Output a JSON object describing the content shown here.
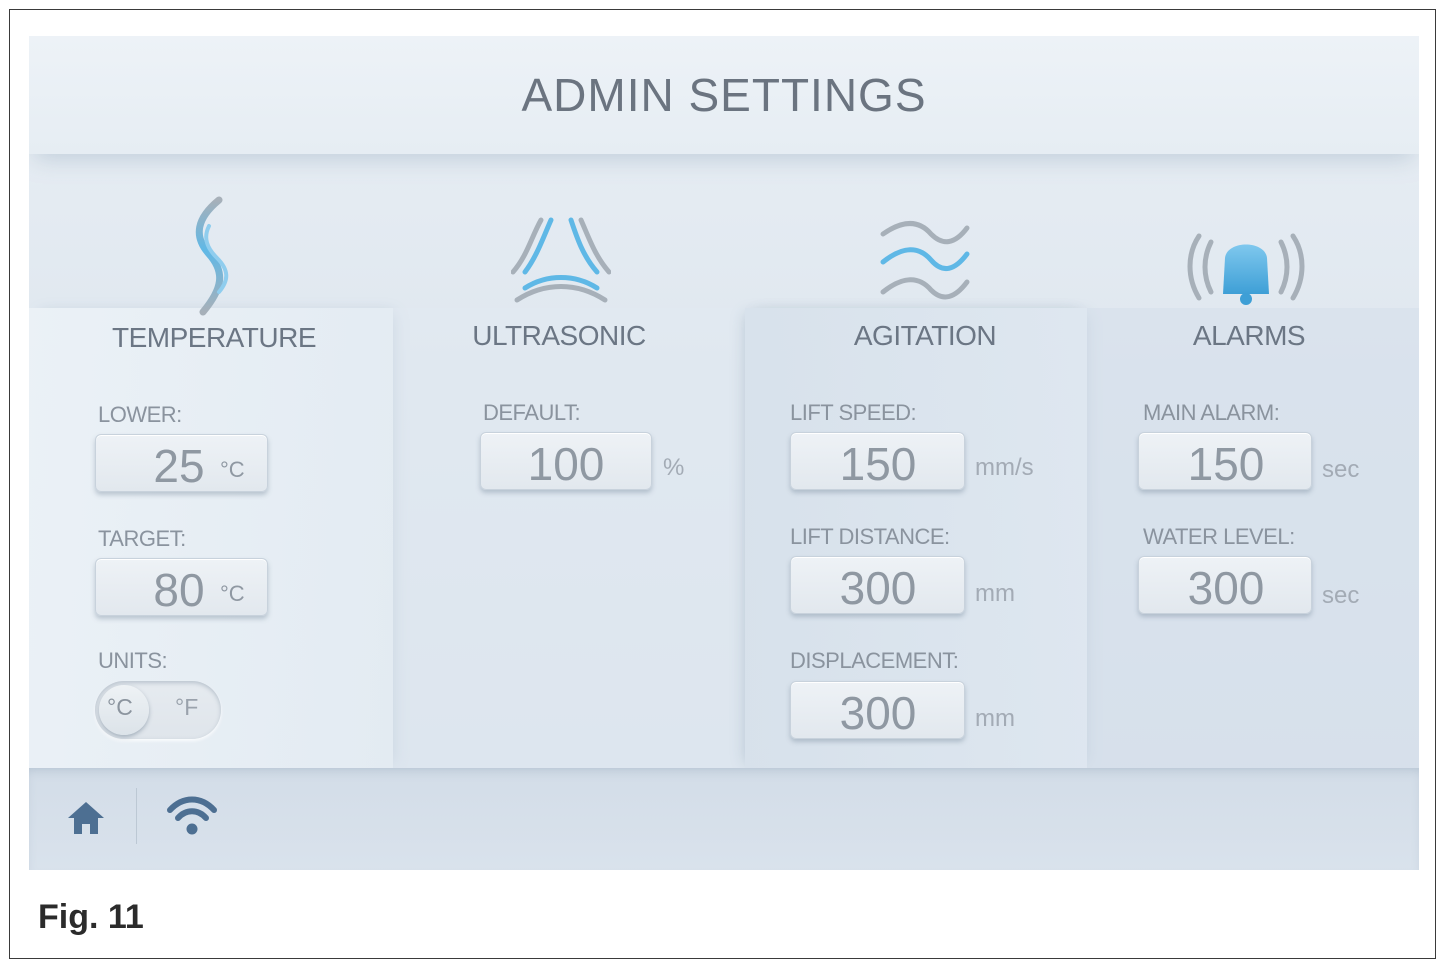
{
  "header": {
    "title": "ADMIN SETTINGS"
  },
  "temperature": {
    "label": "TEMPERATURE",
    "icon": "heat-wave-icon",
    "lower": {
      "label": "LOWER:",
      "value": "25",
      "unit": "°C"
    },
    "target": {
      "label": "TARGET:",
      "value": "80",
      "unit": "°C"
    },
    "units": {
      "label": "UNITS:",
      "option_c": "°C",
      "option_f": "°F",
      "selected": "°C"
    }
  },
  "ultrasonic": {
    "label": "ULTRASONIC",
    "icon": "ultrasonic-waves-icon",
    "default": {
      "label": "DEFAULT:",
      "value": "100",
      "unit": "%"
    }
  },
  "agitation": {
    "label": "AGITATION",
    "icon": "agitation-waves-icon",
    "lift_speed": {
      "label": "LIFT SPEED:",
      "value": "150",
      "unit": "mm/s"
    },
    "lift_distance": {
      "label": "LIFT DISTANCE:",
      "value": "300",
      "unit": "mm"
    },
    "displacement": {
      "label": "DISPLACEMENT:",
      "value": "300",
      "unit": "mm"
    }
  },
  "alarms": {
    "label": "ALARMS",
    "icon": "bell-icon",
    "main_alarm": {
      "label": "MAIN ALARM:",
      "value": "150",
      "unit": "sec"
    },
    "water_level": {
      "label": "WATER LEVEL:",
      "value": "300",
      "unit": "sec"
    }
  },
  "footer": {
    "home_icon": "home-icon",
    "wifi_icon": "wifi-icon"
  },
  "caption": "Fig. 11",
  "colors": {
    "accent": "#5fb8e6",
    "icon_gray": "#a9b1ba",
    "footer_icon": "#4d6f92"
  }
}
